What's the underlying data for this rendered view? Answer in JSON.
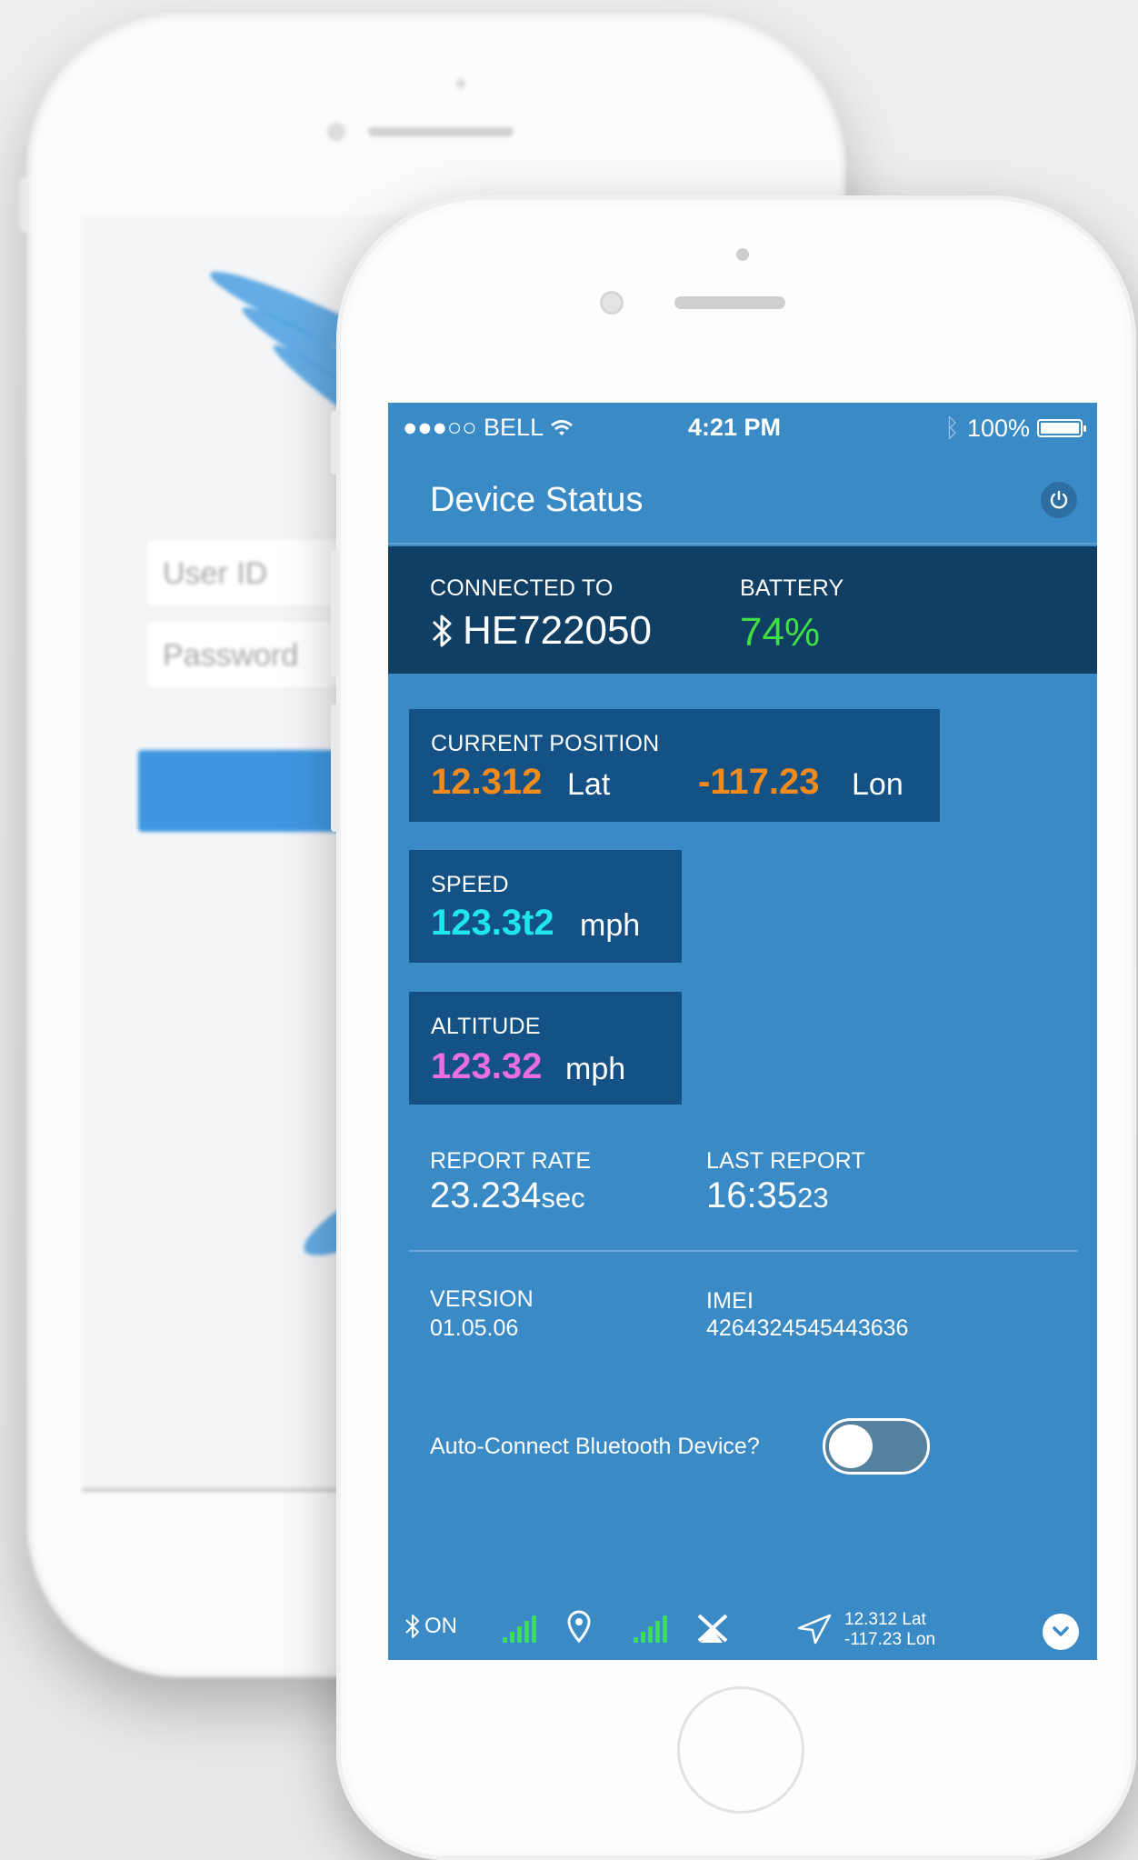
{
  "back_phone": {
    "user_id_placeholder": "User ID",
    "password_placeholder": "Password"
  },
  "status_bar": {
    "carrier": "●●●○○ BELL",
    "time": "4:21 PM",
    "battery_percent": "100%"
  },
  "nav": {
    "title": "Device Status"
  },
  "connection": {
    "connected_label": "CONNECTED TO",
    "device_id": "HE722050",
    "battery_label": "BATTERY",
    "battery_value": "74%"
  },
  "position": {
    "label": "CURRENT POSITION",
    "lat": "12.312",
    "lat_unit": "Lat",
    "lon": "-117.23",
    "lon_unit": "Lon"
  },
  "speed": {
    "label": "SPEED",
    "value": "123.3t2",
    "unit": "mph"
  },
  "altitude": {
    "label": "ALTITUDE",
    "value": "123.32",
    "unit": "mph"
  },
  "report": {
    "rate_label": "REPORT RATE",
    "rate_value": "23.234",
    "rate_unit": "sec",
    "last_label": "LAST REPORT",
    "last_value": "16:35",
    "last_seconds": "23"
  },
  "device_info": {
    "version_label": "VERSION",
    "version_value": "01.05.06",
    "imei_label": "IMEI",
    "imei_value": "4264324545443636"
  },
  "auto_connect": {
    "label": "Auto-Connect Bluetooth Device?",
    "enabled": false
  },
  "bottom_bar": {
    "bt_status": "ON",
    "lat": "12.312 Lat",
    "lon": "-117.23 Lon"
  },
  "colors": {
    "screen_bg": "#3a8ac6",
    "panel_dark": "#113e63",
    "card_bg": "#145184",
    "battery_green": "#3ee046",
    "position_orange": "#f28a1c",
    "speed_cyan": "#1fe6ee",
    "altitude_magenta": "#ea6ee0"
  }
}
